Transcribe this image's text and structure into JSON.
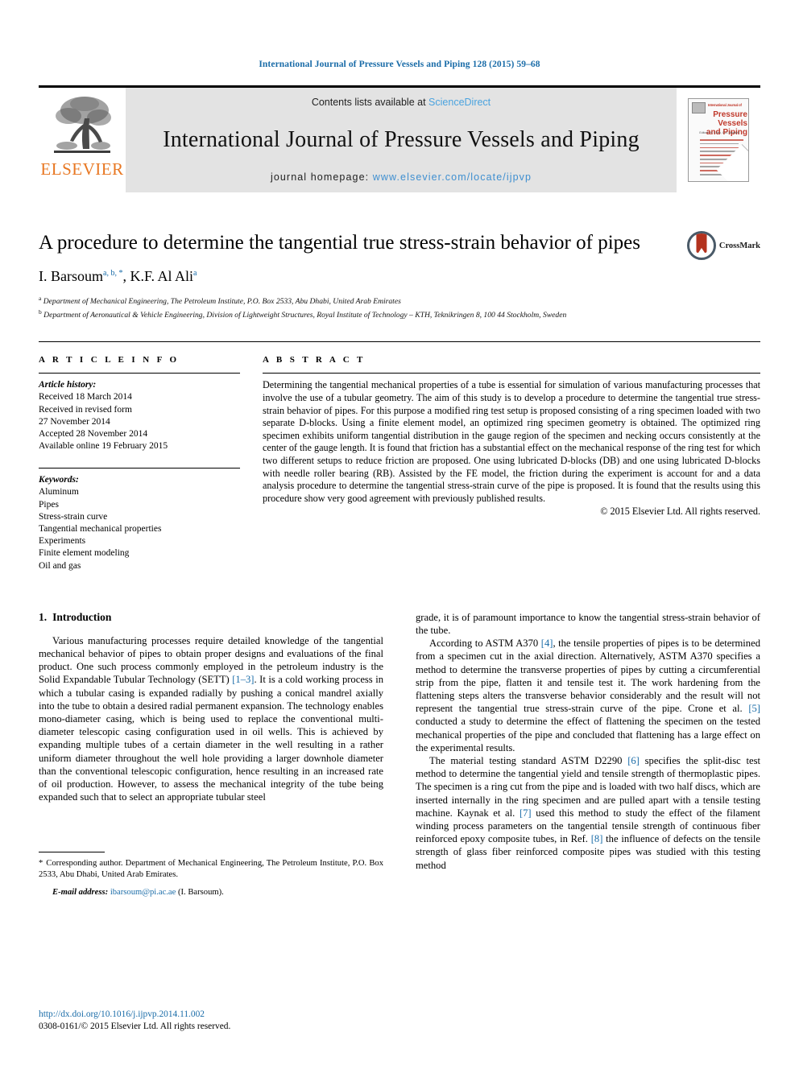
{
  "running_head": "International Journal of Pressure Vessels and Piping 128 (2015) 59–68",
  "journal_header": {
    "publisher_wordmark": "ELSEVIER",
    "contents_prefix": "Contents lists available at",
    "contents_link": "ScienceDirect",
    "journal_title": "International Journal of Pressure Vessels and Piping",
    "homepage_prefix": "journal homepage:",
    "homepage_url": "www.elsevier.com/locate/ijpvp",
    "cover": {
      "kicker": "International Journal of",
      "title_line1": "Pressure Vessels",
      "title_line2": "and Piping",
      "editors": "Editors: H. Chen, C.A. Maxwell"
    }
  },
  "article": {
    "title": "A procedure to determine the tangential true stress-strain behavior of pipes",
    "crossmark_label": "CrossMark",
    "authors_html": "I. Barsoum, K.F. Al Ali",
    "author1_name": "I. Barsoum",
    "author1_marks": "a, b, *",
    "author2_name": "K.F. Al Ali",
    "author2_marks": "a",
    "affiliation_a": "Department of Mechanical Engineering, The Petroleum Institute, P.O. Box 2533, Abu Dhabi, United Arab Emirates",
    "affiliation_b": "Department of Aeronautical & Vehicle Engineering, Division of Lightweight Structures, Royal Institute of Technology – KTH, Teknikringen 8, 100 44 Stockholm, Sweden"
  },
  "article_info": {
    "heading": "A R T I C L E  I N F O",
    "history_label": "Article history:",
    "history": [
      "Received 18 March 2014",
      "Received in revised form",
      "27 November 2014",
      "Accepted 28 November 2014",
      "Available online 19 February 2015"
    ],
    "keywords_label": "Keywords:",
    "keywords": [
      "Aluminum",
      "Pipes",
      "Stress-strain curve",
      "Tangential mechanical properties",
      "Experiments",
      "Finite element modeling",
      "Oil and gas"
    ]
  },
  "abstract": {
    "heading": "A B S T R A C T",
    "text": "Determining the tangential mechanical properties of a tube is essential for simulation of various manufacturing processes that involve the use of a tubular geometry. The aim of this study is to develop a procedure to determine the tangential true stress-strain behavior of pipes. For this purpose a modified ring test setup is proposed consisting of a ring specimen loaded with two separate D-blocks. Using a finite element model, an optimized ring specimen geometry is obtained. The optimized ring specimen exhibits uniform tangential distribution in the gauge region of the specimen and necking occurs consistently at the center of the gauge length. It is found that friction has a substantial effect on the mechanical response of the ring test for which two different setups to reduce friction are proposed. One using lubricated D-blocks (DB) and one using lubricated D-blocks with needle roller bearing (RB). Assisted by the FE model, the friction during the experiment is account for and a data analysis procedure to determine the tangential stress-strain curve of the pipe is proposed. It is found that the results using this procedure show very good agreement with previously published results.",
    "copyright": "© 2015 Elsevier Ltd. All rights reserved."
  },
  "body": {
    "section_number": "1.",
    "section_title": "Introduction",
    "left_p1_a": "Various manufacturing processes require detailed knowledge of the tangential mechanical behavior of pipes to obtain proper designs and evaluations of the final product. One such process commonly employed in the petroleum industry is the Solid Expandable Tubular Technology (SETT) ",
    "left_p1_ref": "[1–3]",
    "left_p1_b": ". It is a cold working process in which a tubular casing is expanded radially by pushing a conical mandrel axially into the tube to obtain a desired radial permanent expansion. The technology enables mono-diameter casing, which is being used to replace the conventional multi-diameter telescopic casing configuration used in oil wells. This is achieved by expanding multiple tubes of a certain diameter in the well resulting in a rather uniform diameter throughout the well hole providing a larger downhole diameter than the conventional telescopic configuration, hence resulting in an increased rate of oil production. However, to assess the mechanical integrity of the tube being expanded such that to select an appropriate tubular steel",
    "right_p1": "grade, it is of paramount importance to know the tangential stress-strain behavior of the tube.",
    "right_p2_a": "According to ASTM A370 ",
    "right_p2_ref1": "[4]",
    "right_p2_b": ", the tensile properties of pipes is to be determined from a specimen cut in the axial direction. Alternatively, ASTM A370 specifies a method to determine the transverse properties of pipes by cutting a circumferential strip from the pipe, flatten it and tensile test it. The work hardening from the flattening steps alters the transverse behavior considerably and the result will not represent the tangential true stress-strain curve of the pipe. Crone et al. ",
    "right_p2_ref2": "[5]",
    "right_p2_c": " conducted a study to determine the effect of flattening the specimen on the tested mechanical properties of the pipe and concluded that flattening has a large effect on the experimental results.",
    "right_p3_a": "The material testing standard ASTM D2290 ",
    "right_p3_ref1": "[6]",
    "right_p3_b": " specifies the split-disc test method to determine the tangential yield and tensile strength of thermoplastic pipes. The specimen is a ring cut from the pipe and is loaded with two half discs, which are inserted internally in the ring specimen and are pulled apart with a tensile testing machine. Kaynak et al. ",
    "right_p3_ref2": "[7]",
    "right_p3_c": " used this method to study the effect of the filament winding process parameters on the tangential tensile strength of continuous fiber reinforced epoxy composite tubes, in Ref. ",
    "right_p3_ref3": "[8]",
    "right_p3_d": " the influence of defects on the tensile strength of glass fiber reinforced composite pipes was studied with this testing method"
  },
  "footnote": {
    "star": "*",
    "text": "Corresponding author. Department of Mechanical Engineering, The Petroleum Institute, P.O. Box 2533, Abu Dhabi, United Arab Emirates.",
    "email_label": "E-mail address:",
    "email": "ibarsoum@pi.ac.ae",
    "email_owner": "(I. Barsoum)."
  },
  "page_footer": {
    "doi": "http://dx.doi.org/10.1016/j.ijpvp.2014.11.002",
    "issn": "0308-0161/© 2015 Elsevier Ltd. All rights reserved."
  },
  "colors": {
    "link_blue": "#1a6ca8",
    "sciencedirect_blue": "#4aa3df",
    "elsevier_orange": "#E87722",
    "band_gray": "#e3e3e3",
    "crossmark_red": "#b3321e"
  }
}
